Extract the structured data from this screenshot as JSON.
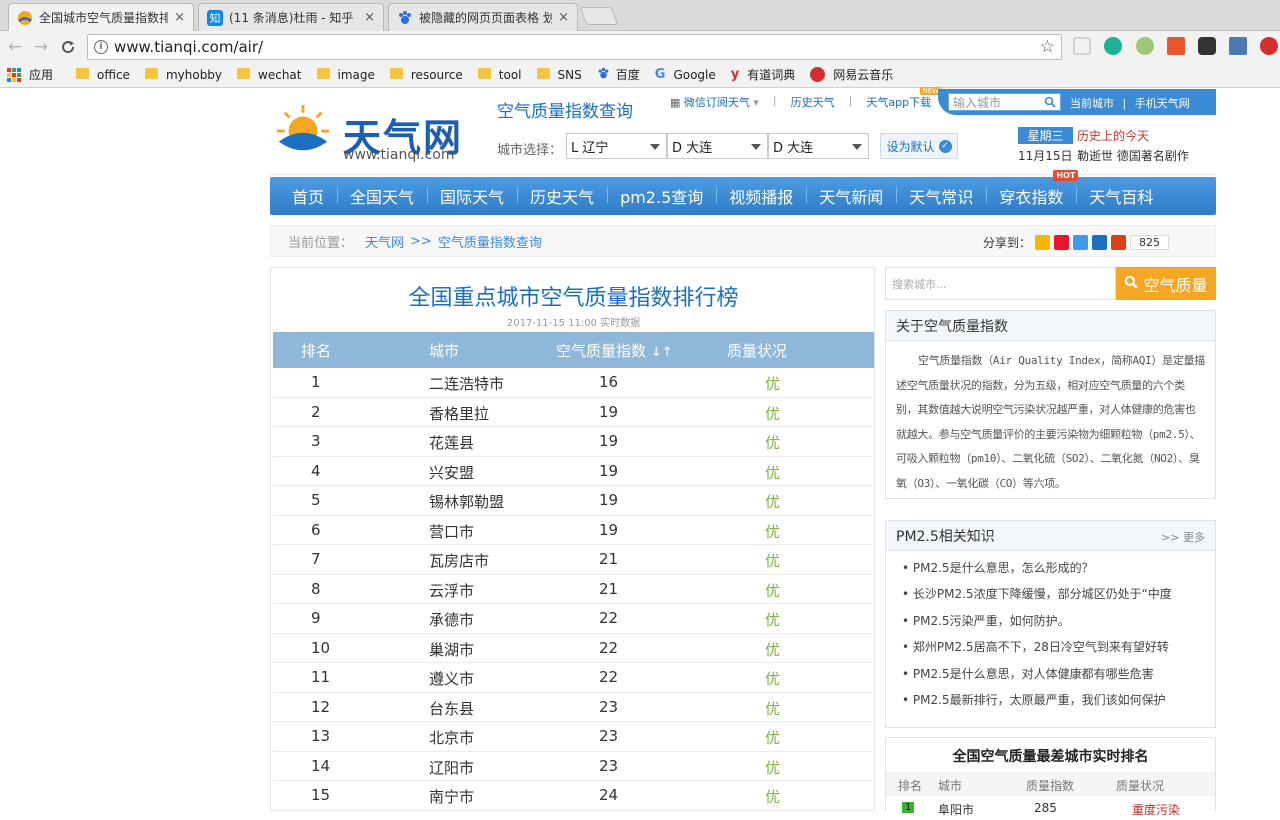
{
  "browser": {
    "tabs": [
      {
        "title": "全国城市空气质量指数排",
        "close": "×",
        "icon_color": "#f5a623",
        "icon": "sun-icon"
      },
      {
        "title": "(11 条消息)杜雨 - 知乎",
        "close": "×",
        "icon_color": "#0f88eb",
        "icon": "zhihu-icon",
        "icon_text": "知"
      },
      {
        "title": "被隐藏的网页页面表格 划",
        "close": "×",
        "icon_color": "#2d6de0",
        "icon": "paw-icon"
      }
    ],
    "url": "www.tianqi.com/air/",
    "bookmarks": [
      {
        "label": "应用",
        "icon": "apps-grid-icon"
      },
      {
        "label": "office",
        "icon": "folder-icon"
      },
      {
        "label": "myhobby",
        "icon": "folder-icon"
      },
      {
        "label": "wechat",
        "icon": "folder-icon"
      },
      {
        "label": "image",
        "icon": "folder-icon"
      },
      {
        "label": "resource",
        "icon": "folder-icon"
      },
      {
        "label": "tool",
        "icon": "folder-icon"
      },
      {
        "label": "SNS",
        "icon": "folder-icon"
      },
      {
        "label": "百度",
        "icon": "baidu-paw-icon"
      },
      {
        "label": "Google",
        "icon": "google-g-icon"
      },
      {
        "label": "有道词典",
        "icon": "youdao-icon"
      },
      {
        "label": "网易云音乐",
        "icon": "netease-music-icon"
      }
    ]
  },
  "header": {
    "logo_name": "天气网",
    "logo_url": "www.tianqi.com",
    "page_title": "空气质量指数查询",
    "links": [
      "微信订阅天气",
      "历史天气",
      "天气app下载"
    ],
    "new_badge": "NEW",
    "search_placeholder": "输入城市",
    "current_city": "当前城市",
    "mobile": "手机天气网",
    "city_select_label": "城市选择：",
    "province": "L 辽宁",
    "city": "D 大连",
    "district": "D 大连",
    "set_default": "设为默认",
    "weekday": "星期三",
    "date": "11月15日",
    "history_label": "历史上的今天",
    "history_text": "勒逝世   德国著名剧作"
  },
  "nav": {
    "items": [
      "首页",
      "全国天气",
      "国际天气",
      "历史天气",
      "pm2.5查询",
      "视频播报",
      "天气新闻",
      "天气常识",
      "穿衣指数",
      "天气百科"
    ],
    "hot_badge": "HOT"
  },
  "breadcrumb": {
    "label": "当前位置：",
    "home": "天气网",
    "separator": ">>",
    "current": "空气质量指数查询",
    "share_label": "分享到：",
    "share_count": "825"
  },
  "ranking": {
    "title": "全国重点城市空气质量指数排行榜",
    "subtitle": "2017-11-15 11:00 实时数据",
    "columns": [
      "排名",
      "城市",
      "空气质量指数",
      "质量状况"
    ],
    "sort_arrows": "↓↑",
    "good_color": "#7cb342",
    "rows": [
      {
        "rank": "1",
        "city": "二连浩特市",
        "aqi": "16",
        "status": "优"
      },
      {
        "rank": "2",
        "city": "香格里拉",
        "aqi": "19",
        "status": "优"
      },
      {
        "rank": "3",
        "city": "花莲县",
        "aqi": "19",
        "status": "优"
      },
      {
        "rank": "4",
        "city": "兴安盟",
        "aqi": "19",
        "status": "优"
      },
      {
        "rank": "5",
        "city": "锡林郭勒盟",
        "aqi": "19",
        "status": "优"
      },
      {
        "rank": "6",
        "city": "营口市",
        "aqi": "19",
        "status": "优"
      },
      {
        "rank": "7",
        "city": "瓦房店市",
        "aqi": "21",
        "status": "优"
      },
      {
        "rank": "8",
        "city": "云浮市",
        "aqi": "21",
        "status": "优"
      },
      {
        "rank": "9",
        "city": "承德市",
        "aqi": "22",
        "status": "优"
      },
      {
        "rank": "10",
        "city": "巢湖市",
        "aqi": "22",
        "status": "优"
      },
      {
        "rank": "11",
        "city": "遵义市",
        "aqi": "22",
        "status": "优"
      },
      {
        "rank": "12",
        "city": "台东县",
        "aqi": "23",
        "status": "优"
      },
      {
        "rank": "13",
        "city": "北京市",
        "aqi": "23",
        "status": "优"
      },
      {
        "rank": "14",
        "city": "辽阳市",
        "aqi": "23",
        "status": "优"
      },
      {
        "rank": "15",
        "city": "南宁市",
        "aqi": "24",
        "status": "优"
      }
    ]
  },
  "sidebar": {
    "search_placeholder": "搜索城市...",
    "search_button": "空气质量",
    "about_title": "关于空气质量指数",
    "about_text": "空气质量指数（Air Quality Index，简称AQI）是定量描述空气质量状况的指数，分为五级，相对应空气质量的六个类别，其数值越大说明空气污染状况越严重，对人体健康的危害也就越大。参与空气质量评价的主要污染物为细颗粒物（pm2.5）、可吸入颗粒物（pm10）、二氧化硫（SO2）、二氧化氮（NO2）、臭氧（O3）、一氧化碳（CO）等六项。",
    "pm_title": "PM2.5相关知识",
    "pm_more": ">> 更多",
    "pm_items": [
      "• PM2.5是什么意思，怎么形成的？",
      "• 长沙PM2.5浓度下降缓慢，部分城区仍处于“中度",
      "• PM2.5污染严重，如何防护。",
      "• 郑州PM2.5居高不下，28日冷空气到来有望好转",
      "• PM2.5是什么意思，对人体健康都有哪些危害",
      "• PM2.5最新排行，太原最严重，我们该如何保护"
    ],
    "worst_title": "全国空气质量最差城市实时排名",
    "worst_columns": [
      "排名",
      "城市",
      "质量指数",
      "质量状况"
    ],
    "worst_first": {
      "rank": "1",
      "city": "阜阳市",
      "aqi": "285",
      "status": "重度污染"
    }
  }
}
